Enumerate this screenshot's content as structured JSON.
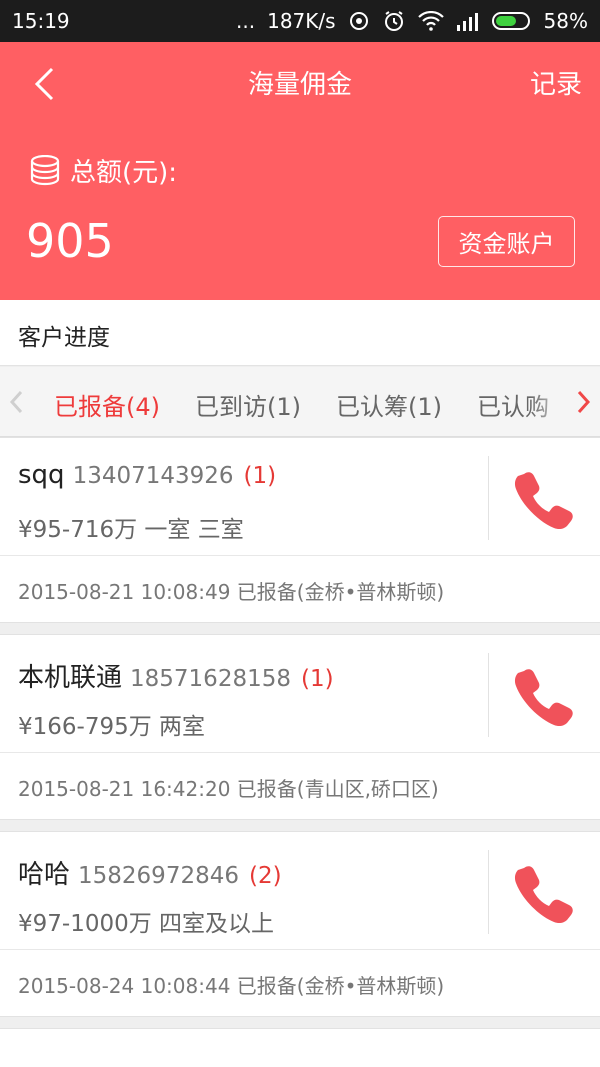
{
  "status_bar": {
    "time": "15:19",
    "dots": "...",
    "speed": "187K/s",
    "battery": "58%"
  },
  "header": {
    "title": "海量佣金",
    "record_label": "记录",
    "total_label": "总额(元):",
    "total_amount": "905",
    "account_button": "资金账户"
  },
  "section": {
    "title": "客户进度"
  },
  "tabs": [
    {
      "label": "已报备(4)",
      "active": true
    },
    {
      "label": "已到访(1)",
      "active": false
    },
    {
      "label": "已认筹(1)",
      "active": false
    },
    {
      "label": "已认购",
      "active": false
    }
  ],
  "customers": [
    {
      "name": "sqq",
      "phone": "13407143926",
      "count": "(1)",
      "price": "¥95-716万 一室 三室",
      "record": "2015-08-21 10:08:49 已报备(金桥•普林斯顿)"
    },
    {
      "name": "本机联通",
      "phone": "18571628158",
      "count": "(1)",
      "price": "¥166-795万 两室",
      "record": "2015-08-21 16:42:20 已报备(青山区,硚口区)"
    },
    {
      "name": "哈哈",
      "phone": "15826972846",
      "count": "(2)",
      "price": "¥97-1000万 四室及以上",
      "record": "2015-08-24 10:08:44 已报备(金桥•普林斯顿)"
    }
  ],
  "colors": {
    "header_bg": "#ff5f63",
    "accent_red": "#e53935",
    "call_icon": "#f0525a"
  }
}
